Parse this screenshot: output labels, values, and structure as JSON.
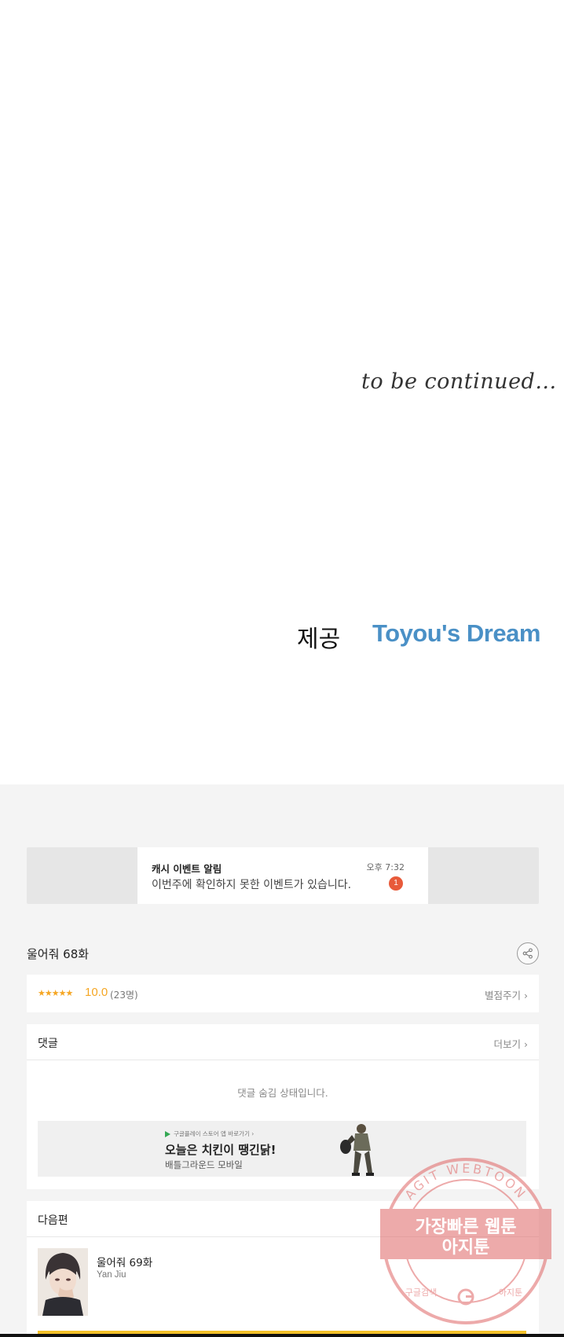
{
  "comic": {
    "to_be_continued": "to be continued...",
    "provided_by_label": "제공",
    "provider_logo_text": "Toyou's Dream"
  },
  "notification": {
    "title": "캐시 이벤트 알림",
    "time": "오후 7:32",
    "message": "이번주에 확인하지 못한 이벤트가 있습니다.",
    "badge_count": "1"
  },
  "episode": {
    "title": "울어줘 68화",
    "share_icon": "share-icon"
  },
  "rating": {
    "stars": "★★★★★",
    "score": "10.0",
    "count": "(23명)",
    "rate_button": "별점주기 ›"
  },
  "comments": {
    "title": "댓글",
    "more_button": "더보기 ›",
    "hidden_message": "댓글 숨김 상태입니다."
  },
  "ad": {
    "store_text": "구글플레이 스토어 앱 바로가기 ›",
    "headline": "오늘은 치킨이 땡긴닭!",
    "subtitle": "배틀그라운드 모바일"
  },
  "next_episode": {
    "section_title": "다음편",
    "episode_title": "울어줘 69화",
    "author": "Yan Jiu"
  },
  "watermark": {
    "ring_text": "AGIT WEBTOON",
    "line1": "가장빠른 웹툰",
    "line2": "아지툰",
    "bottom_left": "구글검색",
    "bottom_right": "아지툰"
  },
  "colors": {
    "accent_yellow": "#f3c12b",
    "star_orange": "#f5a623",
    "badge_red": "#e85a3a",
    "logo_blue": "#4a90c6"
  }
}
